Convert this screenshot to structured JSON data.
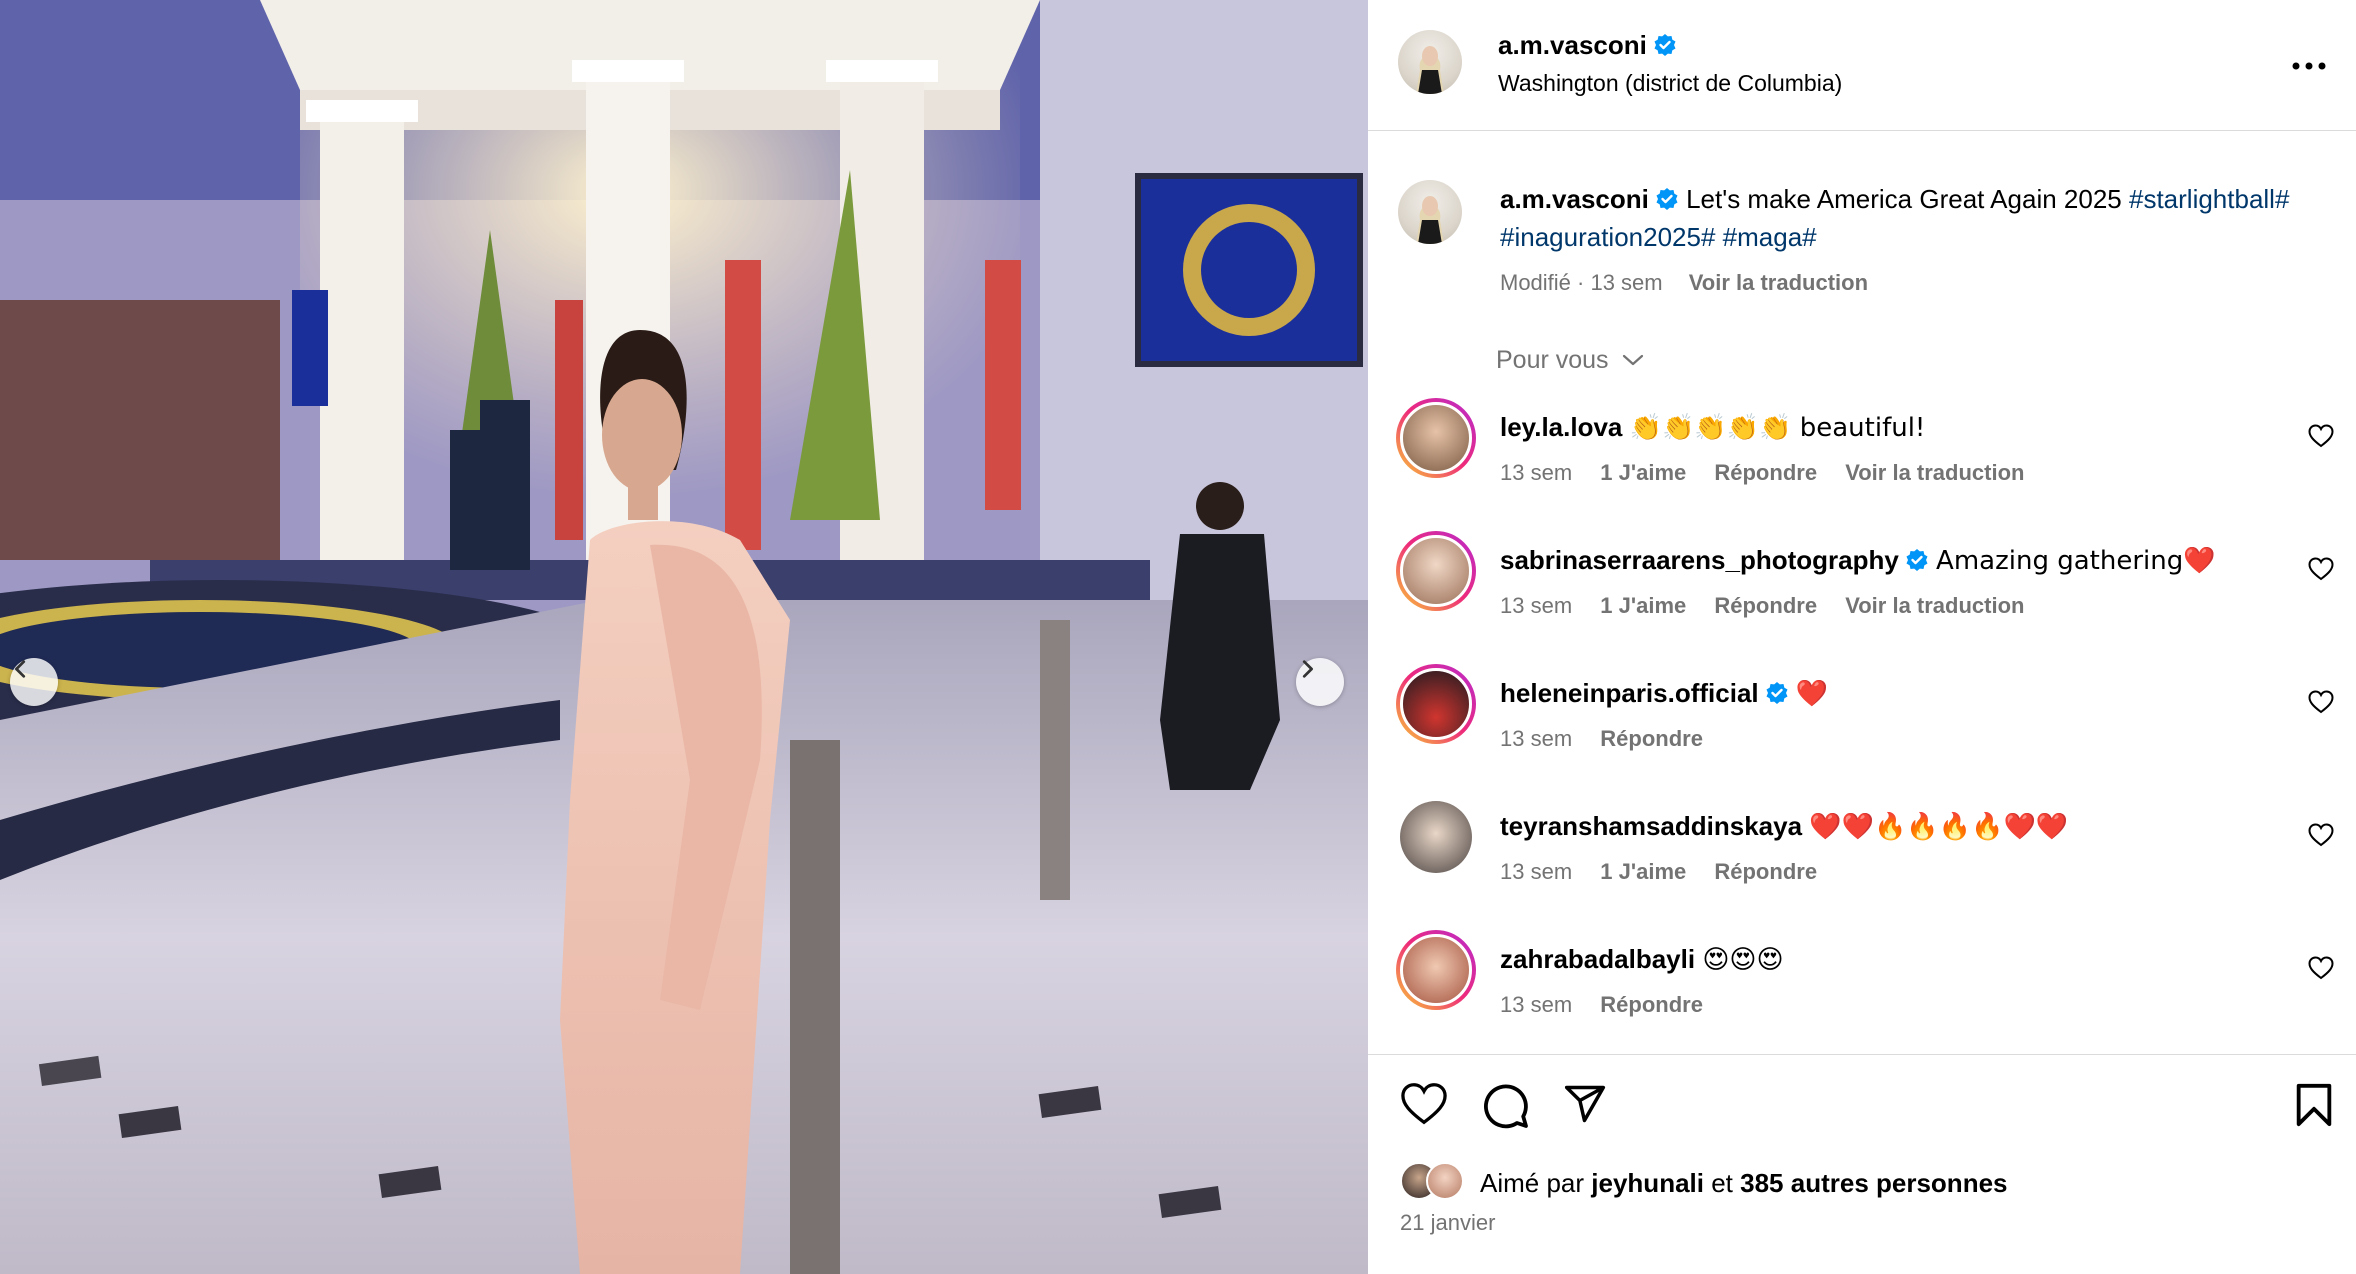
{
  "post": {
    "username": "a.m.vasconi",
    "location": "Washington (district de Columbia)",
    "caption_text": "Let's make America Great Again 2025",
    "hashtags": [
      "#starlightball#",
      "#inaguration2025#",
      "#maga#"
    ],
    "meta_edited": "Modifié · 13 sem",
    "see_translation": "Voir la traduction"
  },
  "filter_label": "Pour vous",
  "comments": [
    {
      "username": "ley.la.lova",
      "verified": false,
      "text": "👏👏👏👏👏 beautiful!",
      "time": "13 sem",
      "likes": "1 J'aime",
      "reply": "Répondre",
      "translate": "Voir la traduction"
    },
    {
      "username": "sabrinaserraarens_photography",
      "verified": true,
      "text": "Amazing gathering❤️",
      "time": "13 sem",
      "likes": "1 J'aime",
      "reply": "Répondre",
      "translate": "Voir la traduction"
    },
    {
      "username": "heleneinparis.official",
      "verified": true,
      "text": "❤️",
      "time": "13 sem",
      "likes": "",
      "reply": "Répondre",
      "translate": ""
    },
    {
      "username": "teyranshamsaddinskaya",
      "verified": false,
      "text": "❤️❤️🔥🔥🔥🔥❤️❤️",
      "time": "13 sem",
      "likes": "1 J'aime",
      "reply": "Répondre",
      "translate": ""
    },
    {
      "username": "zahrabadalbayli",
      "verified": false,
      "text": "😍😍😍",
      "time": "13 sem",
      "likes": "",
      "reply": "Répondre",
      "translate": ""
    }
  ],
  "likes": {
    "prefix": "Aimé par",
    "user": "jeyhunali",
    "joiner": "et",
    "others": "385 autres personnes"
  },
  "date": "21 janvier",
  "colors": {
    "verified_blue": "#0095f6",
    "hashtag_blue": "#00376b",
    "meta_gray": "#737373"
  }
}
